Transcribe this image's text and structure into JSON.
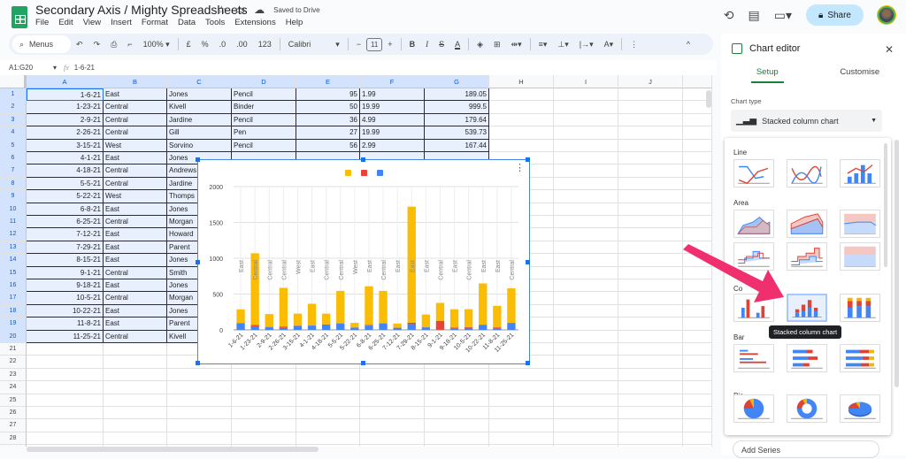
{
  "app": {
    "title": "Secondary Axis / Mighty Spreadsheets",
    "saved_status": "Saved to Drive",
    "menu": [
      "File",
      "Edit",
      "View",
      "Insert",
      "Format",
      "Data",
      "Tools",
      "Extensions",
      "Help"
    ],
    "share_label": "Share"
  },
  "toolbar": {
    "search_label": "Menus",
    "zoom": "100%",
    "currency": "£",
    "percent": "%",
    "dec_decrease": ".0",
    "dec_increase": ".00",
    "number_format": "123",
    "font": "Calibri",
    "font_size": "11"
  },
  "formula": {
    "cell_ref": "A1:G20",
    "fx": "fx",
    "value": "1-6-21"
  },
  "columns": [
    "A",
    "B",
    "C",
    "D",
    "E",
    "F",
    "G",
    "H",
    "I",
    "J"
  ],
  "rows": [
    [
      "1-6-21",
      "East",
      "Jones",
      "Pencil",
      "95",
      "1.99",
      "189.05"
    ],
    [
      "1-23-21",
      "Central",
      "Kivell",
      "Binder",
      "50",
      "19.99",
      "999.5"
    ],
    [
      "2-9-21",
      "Central",
      "Jardine",
      "Pencil",
      "36",
      "4.99",
      "179.64"
    ],
    [
      "2-26-21",
      "Central",
      "Gill",
      "Pen",
      "27",
      "19.99",
      "539.73"
    ],
    [
      "3-15-21",
      "West",
      "Sorvino",
      "Pencil",
      "56",
      "2.99",
      "167.44"
    ],
    [
      "4-1-21",
      "East",
      "Jones",
      "",
      "",
      "",
      ""
    ],
    [
      "4-18-21",
      "Central",
      "Andrews",
      "",
      "",
      "",
      ""
    ],
    [
      "5-5-21",
      "Central",
      "Jardine",
      "",
      "",
      "",
      ""
    ],
    [
      "5-22-21",
      "West",
      "Thomps",
      "",
      "",
      "",
      ""
    ],
    [
      "6-8-21",
      "East",
      "Jones",
      "",
      "",
      "",
      ""
    ],
    [
      "6-25-21",
      "Central",
      "Morgan",
      "",
      "",
      "",
      ""
    ],
    [
      "7-12-21",
      "East",
      "Howard",
      "",
      "",
      "",
      ""
    ],
    [
      "7-29-21",
      "East",
      "Parent",
      "",
      "",
      "",
      ""
    ],
    [
      "8-15-21",
      "East",
      "Jones",
      "",
      "",
      "",
      ""
    ],
    [
      "9-1-21",
      "Central",
      "Smith",
      "",
      "",
      "",
      ""
    ],
    [
      "9-18-21",
      "East",
      "Jones",
      "",
      "",
      "",
      ""
    ],
    [
      "10-5-21",
      "Central",
      "Morgan",
      "",
      "",
      "",
      ""
    ],
    [
      "10-22-21",
      "East",
      "Jones",
      "",
      "",
      "",
      ""
    ],
    [
      "11-8-21",
      "East",
      "Parent",
      "",
      "",
      "",
      ""
    ],
    [
      "11-25-21",
      "Central",
      "Kivell",
      "",
      "",
      "",
      ""
    ]
  ],
  "total_rows_visible": 29,
  "chart_data": {
    "type": "bar",
    "stacked": true,
    "title": "",
    "xlabel": "",
    "ylabel": "",
    "ylim": [
      0,
      2000
    ],
    "yticks": [
      0,
      500,
      1000,
      1500,
      2000
    ],
    "grid": true,
    "legend": "top",
    "categories": [
      "1-6-21",
      "1-23-21",
      "2-9-21",
      "2-26-21",
      "3-15-21",
      "4-1-21",
      "4-18-21",
      "5-5-21",
      "5-22-21",
      "6-8-21",
      "6-25-21",
      "7-12-21",
      "7-29-21",
      "8-15-21",
      "9-1-21",
      "9-18-21",
      "10-5-21",
      "10-22-21",
      "11-8-21",
      "11-25-21"
    ],
    "annotations": [
      "East",
      "Central",
      "Central",
      "Central",
      "West",
      "East",
      "Central",
      "Central",
      "West",
      "East",
      "Central",
      "East",
      "East",
      "East",
      "Central",
      "East",
      "Central",
      "East",
      "East",
      "Central"
    ],
    "series": [
      {
        "name": "",
        "color": "#4285f4",
        "values": [
          95,
          50,
          36,
          27,
          56,
          60,
          75,
          90,
          32,
          60,
          90,
          29,
          81,
          35,
          2,
          16,
          28,
          64,
          15,
          96
        ]
      },
      {
        "name": "",
        "color": "#ea4335",
        "values": [
          1.99,
          19.99,
          4.99,
          19.99,
          2.99,
          4.99,
          1.99,
          4.99,
          1.99,
          8.99,
          4.99,
          1.99,
          19.99,
          4.99,
          125,
          15.99,
          8.99,
          8.99,
          19.99,
          4.99
        ]
      },
      {
        "name": "",
        "color": "#fbbc04",
        "values": [
          189.05,
          999.5,
          179.64,
          539.73,
          167.44,
          299.4,
          149.25,
          449.1,
          63.68,
          539.4,
          449.1,
          57.71,
          1619.19,
          174.65,
          250,
          255.84,
          251.72,
          575.36,
          299.85,
          479.04
        ]
      }
    ]
  },
  "editor": {
    "title": "Chart editor",
    "tabs": [
      "Setup",
      "Customise"
    ],
    "chart_type_label": "Chart type",
    "chart_type_value": "Stacked column chart",
    "sections": [
      "Line",
      "Area",
      "Column",
      "Bar",
      "Pie"
    ],
    "tooltip": "Stacked column chart",
    "add_series": "Add Series"
  }
}
